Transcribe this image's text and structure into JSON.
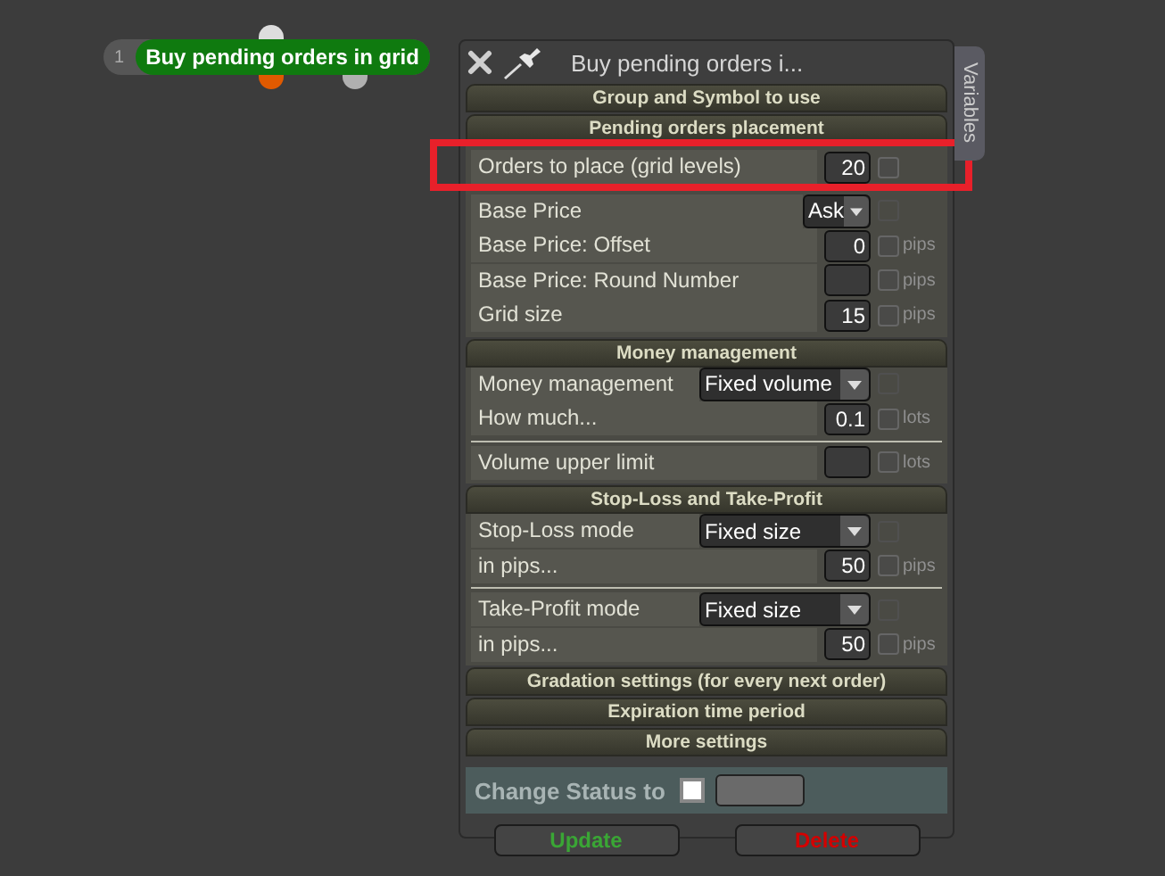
{
  "node": {
    "number": "1",
    "title": "Buy pending orders in grid"
  },
  "panel": {
    "title": "Buy pending orders i...",
    "side_tab": "Variables",
    "sections": [
      {
        "title": "Group and Symbol to use",
        "expanded": false
      },
      {
        "title": "Pending orders placement",
        "expanded": true,
        "groups": [
          {
            "rows": [
              {
                "kind": "input",
                "label": "Orders to place (grid levels)",
                "value": "20",
                "checked": false,
                "highlighted": true
              }
            ]
          },
          {
            "rows": [
              {
                "kind": "select",
                "label": "Base Price",
                "value": "Ask",
                "checked": false
              },
              {
                "kind": "input",
                "label": "Base Price: Offset",
                "value": "0",
                "unit": "pips",
                "checked": false
              },
              {
                "kind": "input",
                "label": "Base Price: Round Number",
                "value": "",
                "unit": "pips",
                "checked": false
              },
              {
                "kind": "input",
                "label": "Grid size",
                "value": "15",
                "unit": "pips",
                "checked": false
              }
            ]
          }
        ]
      },
      {
        "title": "Money management",
        "expanded": true,
        "groups": [
          {
            "rows": [
              {
                "kind": "select",
                "label": "Money management",
                "value": "Fixed volume",
                "checked": false
              },
              {
                "kind": "input",
                "label": "How much...",
                "value": "0.1",
                "unit": "lots",
                "checked": false
              }
            ]
          },
          {
            "rows": [
              {
                "kind": "input",
                "label": "Volume upper limit",
                "value": "",
                "unit": "lots",
                "checked": false
              }
            ]
          }
        ]
      },
      {
        "title": "Stop-Loss and Take-Profit",
        "expanded": true,
        "groups": [
          {
            "rows": [
              {
                "kind": "select",
                "label": "Stop-Loss mode",
                "value": "Fixed size",
                "checked": false
              },
              {
                "kind": "input",
                "label": "in pips...",
                "value": "50",
                "unit": "pips",
                "checked": false
              }
            ]
          },
          {
            "rows": [
              {
                "kind": "select",
                "label": "Take-Profit mode",
                "value": "Fixed size",
                "checked": false
              },
              {
                "kind": "input",
                "label": "in pips...",
                "value": "50",
                "unit": "pips",
                "checked": false
              }
            ]
          }
        ]
      },
      {
        "title": "Gradation settings (for every next order)",
        "expanded": false
      },
      {
        "title": "Expiration time period",
        "expanded": false
      },
      {
        "title": "More settings",
        "expanded": false
      }
    ],
    "status": {
      "label": "Change Status to",
      "checked": false
    },
    "buttons": [
      {
        "label": "Update",
        "color": "#3aa635"
      },
      {
        "label": "Delete",
        "color": "#d40000"
      }
    ]
  }
}
